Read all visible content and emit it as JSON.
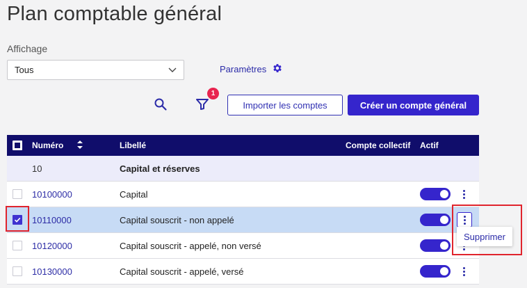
{
  "page": {
    "title": "Plan comptable général"
  },
  "filter": {
    "label": "Affichage",
    "selected": "Tous"
  },
  "params": {
    "label": "Paramètres",
    "icon": "gear-icon"
  },
  "toolbar": {
    "search_icon": "search-icon",
    "filter_icon": "filter-icon",
    "filter_badge": "1",
    "import_label": "Importer les comptes",
    "create_label": "Créer un compte général"
  },
  "table": {
    "headers": {
      "numero": "Numéro",
      "libelle": "Libellé",
      "collectif": "Compte collectif",
      "actif": "Actif"
    },
    "rows": [
      {
        "numero": "10",
        "libelle": "Capital et réserves",
        "group": true
      },
      {
        "numero": "10100000",
        "libelle": "Capital",
        "actif": true
      },
      {
        "numero": "10110000",
        "libelle": "Capital souscrit - non appelé",
        "actif": true,
        "selected": true
      },
      {
        "numero": "10120000",
        "libelle": "Capital souscrit - appelé, non versé",
        "actif": true
      },
      {
        "numero": "10130000",
        "libelle": "Capital souscrit - appelé, versé",
        "actif": true
      }
    ]
  },
  "row_menu": {
    "delete_label": "Supprimer"
  },
  "colors": {
    "primary": "#3525cc",
    "header_bg": "#100d6b",
    "badge": "#e8244f",
    "highlight": "#e0242d",
    "selected_row": "#c7dbf5"
  }
}
